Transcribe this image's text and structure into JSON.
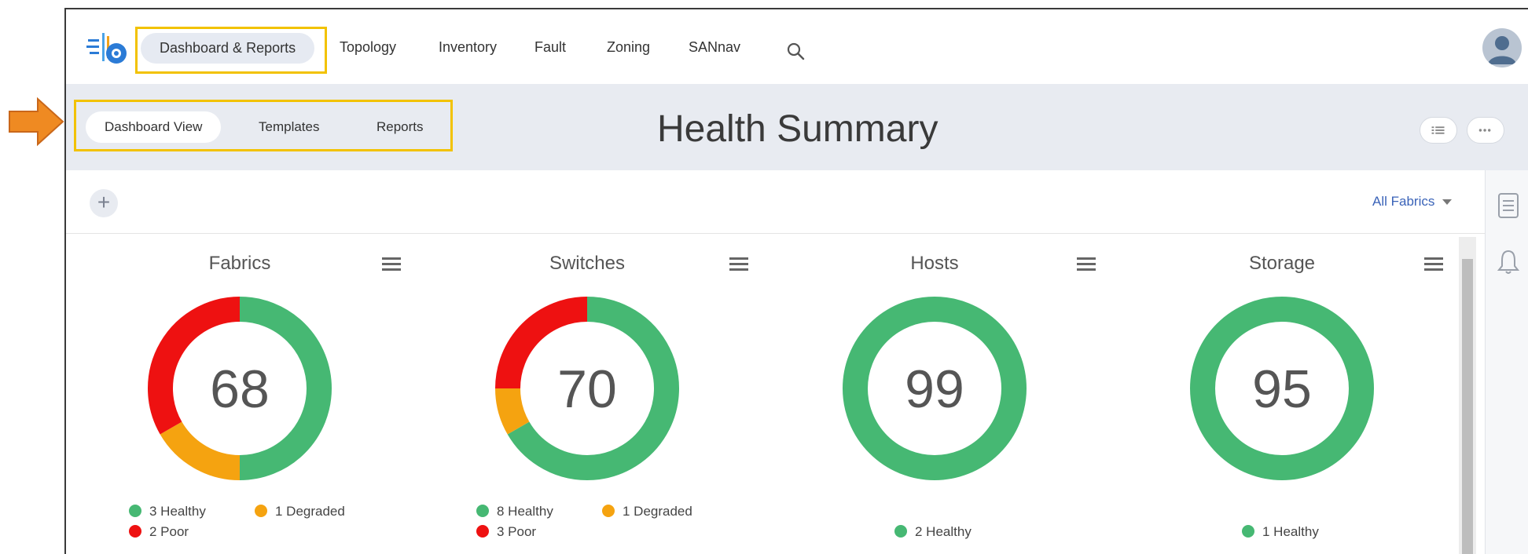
{
  "colors": {
    "healthy": "#46b873",
    "degraded": "#f5a310",
    "poor": "#ee1111",
    "accent": "#f2c200"
  },
  "nav": {
    "items": [
      {
        "label": "Dashboard & Reports"
      },
      {
        "label": "Topology"
      },
      {
        "label": "Inventory"
      },
      {
        "label": "Fault"
      },
      {
        "label": "Zoning"
      },
      {
        "label": "SANnav"
      }
    ]
  },
  "subnav": {
    "tabs": [
      {
        "label": "Dashboard View"
      },
      {
        "label": "Templates"
      },
      {
        "label": "Reports"
      }
    ]
  },
  "page": {
    "title": "Health Summary"
  },
  "toolbar": {
    "filter_label": "All Fabrics"
  },
  "cards": [
    {
      "title": "Fabrics",
      "score": "68",
      "healthy": 3,
      "degraded": 1,
      "poor": 2,
      "legend": {
        "healthy": "3 Healthy",
        "degraded": "1 Degraded",
        "poor": "2 Poor"
      }
    },
    {
      "title": "Switches",
      "score": "70",
      "healthy": 8,
      "degraded": 1,
      "poor": 3,
      "legend": {
        "healthy": "8 Healthy",
        "degraded": "1 Degraded",
        "poor": "3 Poor"
      }
    },
    {
      "title": "Hosts",
      "score": "99",
      "healthy": 2,
      "degraded": 0,
      "poor": 0,
      "legend": {
        "healthy": "2 Healthy"
      }
    },
    {
      "title": "Storage",
      "score": "95",
      "healthy": 1,
      "degraded": 0,
      "poor": 0,
      "legend": {
        "healthy": "1 Healthy"
      }
    }
  ]
}
